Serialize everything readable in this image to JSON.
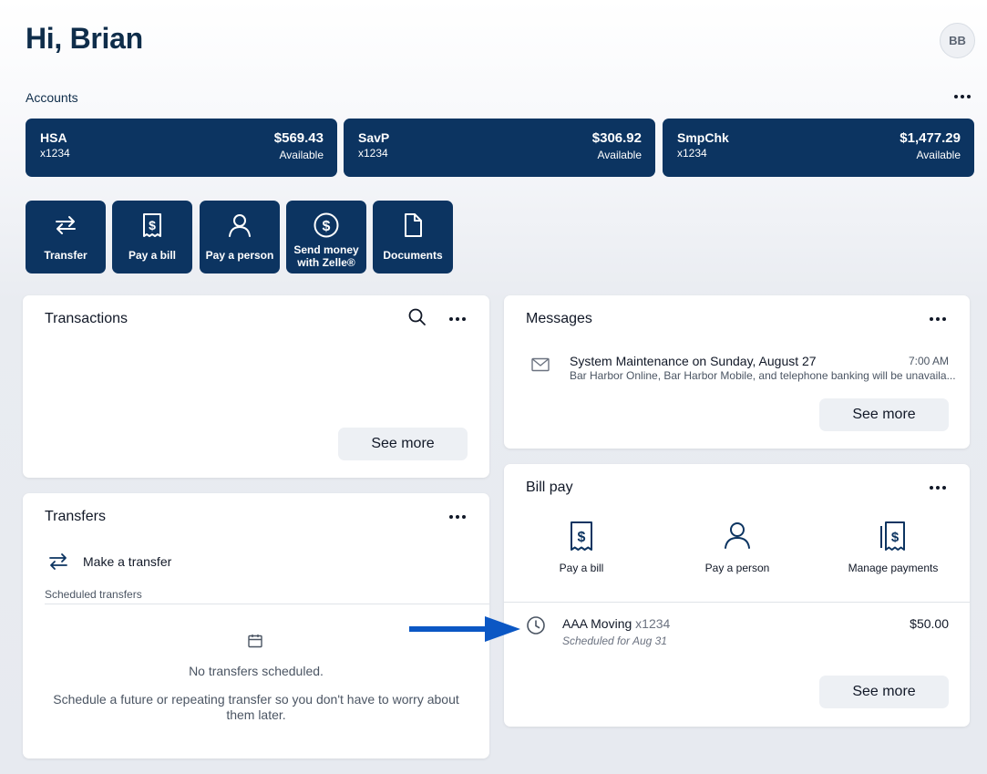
{
  "header": {
    "greeting": "Hi, Brian",
    "avatar_initials": "BB"
  },
  "accounts": {
    "title": "Accounts",
    "items": [
      {
        "name": "HSA",
        "number": "x1234",
        "balance": "$569.43",
        "balance_label": "Available"
      },
      {
        "name": "SavP",
        "number": "x1234",
        "balance": "$306.92",
        "balance_label": "Available"
      },
      {
        "name": "SmpChk",
        "number": "x1234",
        "balance": "$1,477.29",
        "balance_label": "Available"
      }
    ]
  },
  "quick_actions": [
    {
      "label": "Transfer",
      "icon": "transfer-icon"
    },
    {
      "label": "Pay a bill",
      "icon": "bill-icon"
    },
    {
      "label": "Pay a person",
      "icon": "person-icon"
    },
    {
      "label": "Send money with Zelle®",
      "icon": "dollar-circle-icon"
    },
    {
      "label": "Documents",
      "icon": "document-icon"
    }
  ],
  "transactions": {
    "title": "Transactions",
    "see_more": "See more"
  },
  "transfers": {
    "title": "Transfers",
    "make_transfer": "Make a transfer",
    "scheduled_label": "Scheduled transfers",
    "empty_title": "No transfers scheduled.",
    "empty_body": "Schedule a future or repeating transfer so you don't have to worry about them later."
  },
  "messages": {
    "title": "Messages",
    "items": [
      {
        "subject": "System Maintenance on Sunday, August 27",
        "time": "7:00 AM",
        "preview": "Bar Harbor Online, Bar Harbor Mobile, and telephone banking will be unavaila..."
      }
    ],
    "see_more": "See more"
  },
  "bill_pay": {
    "title": "Bill pay",
    "actions": [
      {
        "label": "Pay a bill",
        "icon": "bill-icon"
      },
      {
        "label": "Pay a person",
        "icon": "person-icon"
      },
      {
        "label": "Manage payments",
        "icon": "manage-payments-icon"
      }
    ],
    "scheduled": [
      {
        "payee": "AAA Moving",
        "account": "x1234",
        "amount": "$50.00",
        "status": "Scheduled for Aug 31"
      }
    ],
    "see_more": "See more"
  },
  "colors": {
    "brand_navy": "#0c3461",
    "annotation_arrow": "#0b57c4",
    "page_bg": "#e9ecf1"
  }
}
